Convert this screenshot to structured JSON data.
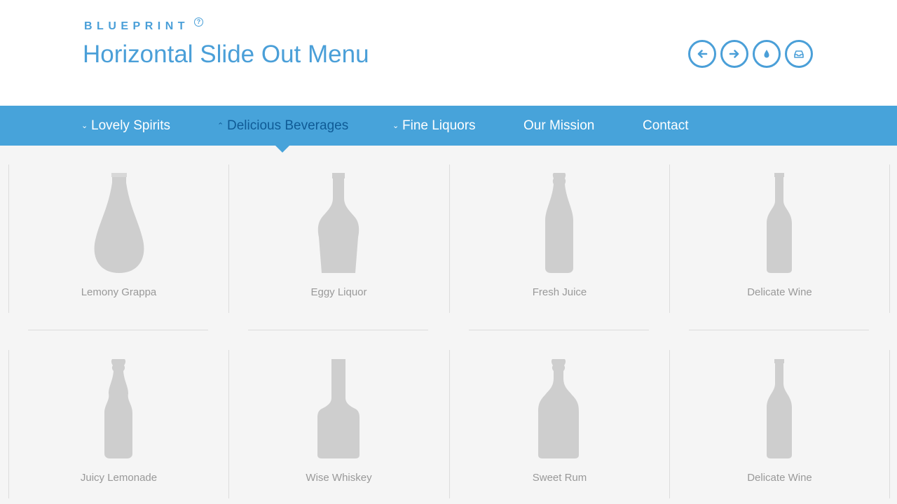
{
  "header": {
    "brand": "BLUEPRINT",
    "help_glyph": "?",
    "title": "Horizontal Slide Out Menu",
    "toolbar": [
      {
        "icon": "arrow-left-icon"
      },
      {
        "icon": "arrow-right-icon"
      },
      {
        "icon": "drop-icon"
      },
      {
        "icon": "inbox-icon"
      }
    ]
  },
  "nav": {
    "items": [
      {
        "label": "Lovely Spirits",
        "chevron": "⌄",
        "state": "collapsed"
      },
      {
        "label": "Delicious Beverages",
        "chevron": "⌃",
        "state": "expanded"
      },
      {
        "label": "Fine Liquors",
        "chevron": "⌄",
        "state": "collapsed"
      },
      {
        "label": "Our Mission"
      },
      {
        "label": "Contact"
      }
    ]
  },
  "products": [
    {
      "name": "Lemony Grappa",
      "shape": "grappa"
    },
    {
      "name": "Eggy Liquor",
      "shape": "liquor"
    },
    {
      "name": "Fresh Juice",
      "shape": "juice"
    },
    {
      "name": "Delicate Wine",
      "shape": "wine"
    },
    {
      "name": "Juicy Lemonade",
      "shape": "lemonade"
    },
    {
      "name": "Wise Whiskey",
      "shape": "whiskey"
    },
    {
      "name": "Sweet Rum",
      "shape": "rum"
    },
    {
      "name": "Delicate Wine",
      "shape": "wine"
    }
  ],
  "colors": {
    "accent": "#47a3da",
    "active_nav": "#0f5b96",
    "bottle": "#cecece",
    "panel_bg": "#f5f5f5"
  }
}
